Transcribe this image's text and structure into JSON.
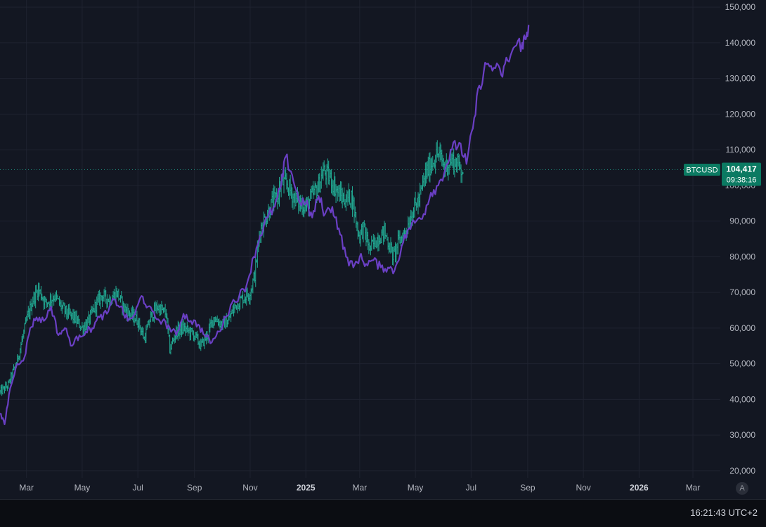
{
  "chart_data": {
    "type": "line",
    "symbol": "BTCUSD",
    "colors": {
      "background": "#131722",
      "grid": "#1f2330",
      "price_series": "#22ab94",
      "overlay_series": "#6a3fc4",
      "price_label_bg": "#0b7a62"
    },
    "y_axis": {
      "range": [
        18000,
        152000
      ],
      "ticks": [
        "20,000",
        "30,000",
        "40,000",
        "50,000",
        "60,000",
        "70,000",
        "80,000",
        "90,000",
        "100,000",
        "110,000",
        "120,000",
        "130,000",
        "140,000",
        "150,000"
      ]
    },
    "x_axis": {
      "range": [
        "2024-02-01",
        "2026-03-31"
      ],
      "ticks": [
        "Mar",
        "May",
        "Jul",
        "Sep",
        "Nov",
        "2025",
        "Mar",
        "May",
        "Jul",
        "Sep",
        "Nov",
        "2026",
        "Mar"
      ],
      "tick_dates": [
        "2024-03-01",
        "2024-05-01",
        "2024-07-01",
        "2024-09-01",
        "2024-11-01",
        "2025-01-01",
        "2025-03-01",
        "2025-05-01",
        "2025-07-01",
        "2025-09-01",
        "2025-11-01",
        "2026-01-01",
        "2026-03-01"
      ]
    },
    "grid": true,
    "current_price": {
      "label": "BTCUSD",
      "value": 104417,
      "value_text": "104,417",
      "countdown": "09:38:16"
    },
    "series": [
      {
        "style": "ohlc-bars",
        "x": [
          "2024-02-01",
          "2024-02-10",
          "2024-02-20",
          "2024-03-01",
          "2024-03-08",
          "2024-03-14",
          "2024-03-22",
          "2024-04-01",
          "2024-04-08",
          "2024-04-15",
          "2024-04-22",
          "2024-05-01",
          "2024-05-08",
          "2024-05-15",
          "2024-05-22",
          "2024-06-01",
          "2024-06-08",
          "2024-06-15",
          "2024-06-22",
          "2024-07-01",
          "2024-07-08",
          "2024-07-15",
          "2024-07-22",
          "2024-08-01",
          "2024-08-05",
          "2024-08-12",
          "2024-08-20",
          "2024-09-01",
          "2024-09-08",
          "2024-09-15",
          "2024-09-22",
          "2024-10-01",
          "2024-10-08",
          "2024-10-15",
          "2024-10-22",
          "2024-11-01",
          "2024-11-06",
          "2024-11-12",
          "2024-11-18",
          "2024-11-25",
          "2024-12-01",
          "2024-12-05",
          "2024-12-12",
          "2024-12-18",
          "2024-12-25",
          "2025-01-01",
          "2025-01-08",
          "2025-01-15",
          "2025-01-20",
          "2025-01-28",
          "2025-02-05",
          "2025-02-12",
          "2025-02-20",
          "2025-02-28",
          "2025-03-05",
          "2025-03-12",
          "2025-03-20",
          "2025-03-28",
          "2025-04-07",
          "2025-04-12",
          "2025-04-20",
          "2025-04-28",
          "2025-05-05",
          "2025-05-12",
          "2025-05-20",
          "2025-05-26",
          "2025-06-02",
          "2025-06-09",
          "2025-06-16",
          "2025-06-22"
        ],
        "values": [
          42000,
          44000,
          51000,
          62000,
          68000,
          71000,
          67000,
          69000,
          66000,
          64000,
          63000,
          60000,
          62000,
          66000,
          69000,
          68000,
          70000,
          66000,
          64000,
          62000,
          57000,
          63000,
          66000,
          64000,
          54000,
          59000,
          60000,
          58000,
          55000,
          58000,
          63000,
          61000,
          62000,
          66000,
          68000,
          70000,
          75000,
          88000,
          91000,
          95000,
          97000,
          101000,
          100000,
          97000,
          95000,
          94000,
          97000,
          100000,
          104000,
          102000,
          98000,
          96000,
          97000,
          86000,
          88000,
          82000,
          85000,
          87000,
          80000,
          84000,
          87000,
          93000,
          96000,
          103000,
          107000,
          109000,
          105000,
          107000,
          106000,
          104417
        ]
      },
      {
        "style": "line",
        "x": [
          "2024-02-01",
          "2024-02-06",
          "2024-02-12",
          "2024-02-20",
          "2024-02-28",
          "2024-03-05",
          "2024-03-12",
          "2024-03-20",
          "2024-03-28",
          "2024-04-05",
          "2024-04-12",
          "2024-04-20",
          "2024-04-28",
          "2024-05-05",
          "2024-05-12",
          "2024-05-20",
          "2024-05-28",
          "2024-06-05",
          "2024-06-12",
          "2024-06-20",
          "2024-06-28",
          "2024-07-05",
          "2024-07-12",
          "2024-07-20",
          "2024-07-28",
          "2024-08-05",
          "2024-08-12",
          "2024-08-20",
          "2024-08-28",
          "2024-09-05",
          "2024-09-12",
          "2024-09-20",
          "2024-09-28",
          "2024-10-05",
          "2024-10-12",
          "2024-10-20",
          "2024-10-28",
          "2024-11-05",
          "2024-11-12",
          "2024-11-20",
          "2024-11-28",
          "2024-12-05",
          "2024-12-10",
          "2024-12-17",
          "2024-12-24",
          "2025-01-01",
          "2025-01-08",
          "2025-01-15",
          "2025-01-22",
          "2025-01-30",
          "2025-02-06",
          "2025-02-14",
          "2025-02-22",
          "2025-03-01",
          "2025-03-08",
          "2025-03-16",
          "2025-03-24",
          "2025-04-01",
          "2025-04-08",
          "2025-04-16",
          "2025-04-24",
          "2025-05-02",
          "2025-05-10",
          "2025-05-18",
          "2025-05-26",
          "2025-06-03",
          "2025-06-10",
          "2025-06-18",
          "2025-06-26",
          "2025-07-03",
          "2025-07-10",
          "2025-07-18",
          "2025-07-26",
          "2025-08-03",
          "2025-08-10",
          "2025-08-18",
          "2025-08-26",
          "2025-08-30",
          "2025-09-02"
        ],
        "values": [
          36000,
          33000,
          43000,
          50000,
          52000,
          60000,
          63000,
          62000,
          66000,
          58000,
          60000,
          55000,
          58000,
          59000,
          60000,
          63000,
          64000,
          68000,
          66000,
          62000,
          64000,
          69000,
          66000,
          63000,
          62000,
          60000,
          58000,
          64000,
          62000,
          61000,
          58000,
          56000,
          59000,
          63000,
          67000,
          69000,
          72000,
          80000,
          86000,
          91000,
          94000,
          100000,
          108000,
          103000,
          96000,
          95000,
          91000,
          97000,
          92000,
          94000,
          88000,
          80000,
          77000,
          80000,
          78000,
          79000,
          77000,
          77000,
          76000,
          83000,
          88000,
          90000,
          92000,
          98000,
          100000,
          105000,
          110000,
          112000,
          106000,
          116000,
          128000,
          134000,
          133000,
          131000,
          135000,
          139000,
          140000,
          141000,
          145000
        ]
      }
    ]
  },
  "status_bar": {
    "clock": "16:21:43 UTC+2",
    "auto_scale_label": "A"
  }
}
